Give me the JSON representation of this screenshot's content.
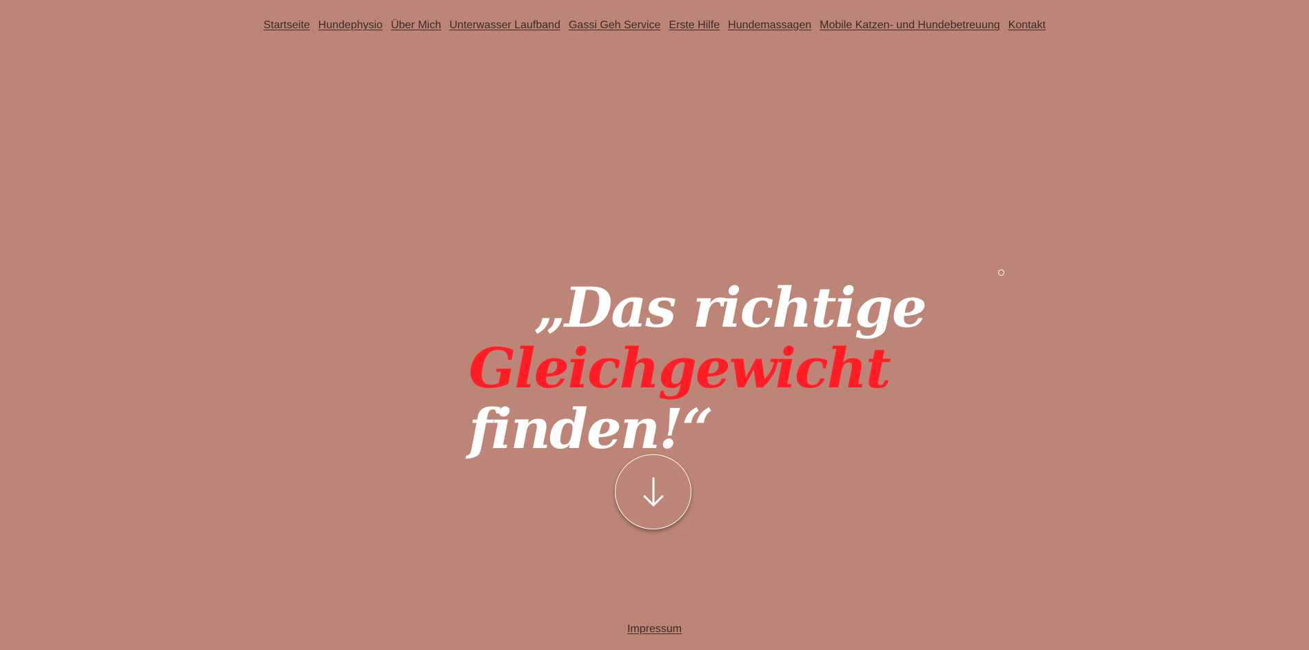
{
  "nav": {
    "items": [
      {
        "label": "Startseite"
      },
      {
        "label": "Hundephysio"
      },
      {
        "label": "Über Mich"
      },
      {
        "label": "Unterwasser Laufband"
      },
      {
        "label": "Gassi Geh Service"
      },
      {
        "label": "Erste Hilfe"
      },
      {
        "label": "Hundemassagen"
      },
      {
        "label": "Mobile Katzen- und Hundebetreuung"
      },
      {
        "label": "Kontakt"
      }
    ]
  },
  "hero": {
    "line1": "„Das richtige",
    "line2": "Gleichgewicht",
    "line3": "finden!“"
  },
  "scroll_button": {
    "icon": "arrow-down-icon"
  },
  "footer": {
    "impressum_label": "Impressum"
  },
  "colors": {
    "background": "#bd8577",
    "accent_red": "#ff1e26",
    "text_light": "#ffffff",
    "link_dark": "#3a2a27"
  }
}
